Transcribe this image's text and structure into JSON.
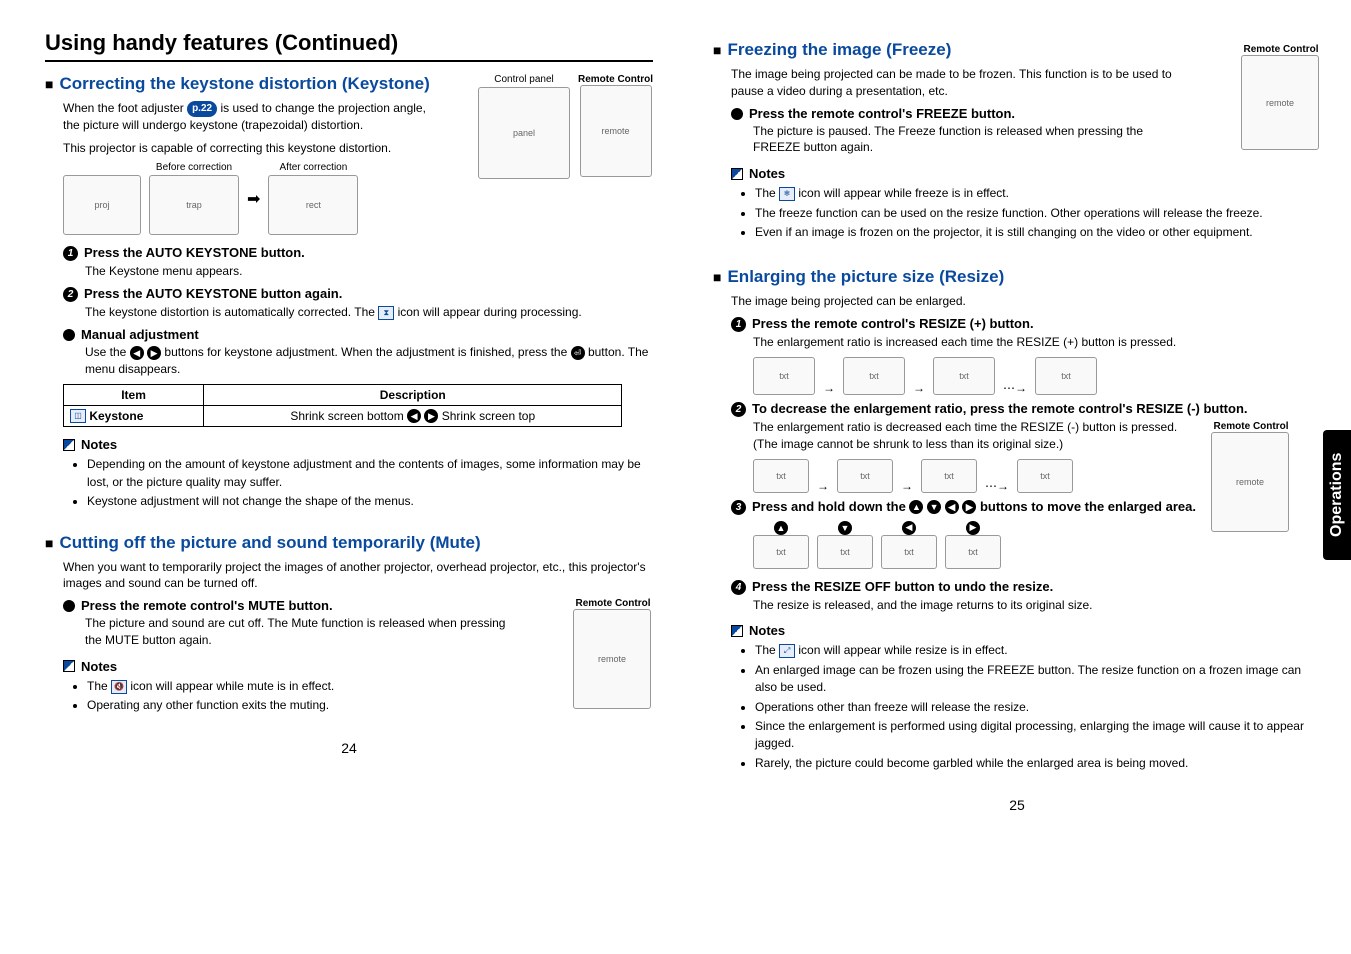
{
  "main_title": "Using handy features (Continued)",
  "side_tab": "Operations",
  "left": {
    "keystone": {
      "heading": "Correcting the keystone distortion (Keystone)",
      "intro_before_ref": "When the foot adjuster ",
      "page_ref": "p.22",
      "intro_after_ref": " is used to change the projection angle, the picture will undergo keystone (trapezoidal) distortion.",
      "intro2": "This projector is capable of correcting this keystone distortion.",
      "before_label": "Before correction",
      "after_label": "After correction",
      "control_panel_label": "Control panel",
      "remote_label": "Remote Control",
      "step1_title": "Press the AUTO KEYSTONE button.",
      "step1_body": "The Keystone menu appears.",
      "step2_title": "Press the AUTO KEYSTONE button again.",
      "step2_body_before": "The keystone distortion is automatically corrected. The ",
      "step2_body_after": " icon will appear during processing.",
      "manual_title": "Manual adjustment",
      "manual_body_a": "Use the ",
      "manual_body_b": " buttons for keystone adjustment. When the adjustment is finished, press the ",
      "manual_body_c": " button. The menu disappears.",
      "table": {
        "headers": [
          "Item",
          "Description"
        ],
        "row": {
          "item": "Keystone",
          "desc_a": "Shrink screen bottom ",
          "desc_b": " Shrink screen top"
        }
      },
      "notes_heading": "Notes",
      "notes": [
        "Depending on the amount of keystone adjustment and the contents of images, some information may be lost, or the picture quality may suffer.",
        "Keystone adjustment will not change the shape of the menus."
      ]
    },
    "mute": {
      "heading": "Cutting off the picture and sound temporarily (Mute)",
      "intro": "When you want to temporarily project the images of another projector, overhead projector, etc., this projector's images and sound can be turned off.",
      "remote_label": "Remote Control",
      "step_title": "Press the remote control's MUTE button.",
      "step_body": "The picture and sound are cut off. The Mute function is released when pressing the MUTE button again.",
      "notes_heading": "Notes",
      "note1_a": "The ",
      "note1_b": " icon will appear while mute is in effect.",
      "note2": "Operating any other function exits the muting."
    },
    "page_number": "24"
  },
  "right": {
    "freeze": {
      "heading": "Freezing the image (Freeze)",
      "intro": "The image being projected can be made to be frozen. This function is to be used to pause a video during a presentation, etc.",
      "remote_label": "Remote Control",
      "step_title": "Press the remote control's FREEZE button.",
      "step_body": "The picture is paused. The Freeze function is released when pressing the FREEZE button again.",
      "notes_heading": "Notes",
      "note1_a": "The ",
      "note1_b": " icon will appear while freeze is in effect.",
      "note2": "The freeze function can be used on the resize function. Other operations will release the freeze.",
      "note3": "Even if an image is frozen on the projector, it is still changing on the video or other equipment."
    },
    "resize": {
      "heading": "Enlarging the picture size (Resize)",
      "intro": "The image being projected can be enlarged.",
      "remote_label": "Remote Control",
      "step1_title": "Press the remote control's RESIZE (+)  button.",
      "step1_body": "The enlargement ratio is increased each time the RESIZE (+)  button is pressed.",
      "step2_title": "To decrease the enlargement ratio, press the remote control's RESIZE (-) button.",
      "step2_body": "The enlargement ratio is decreased each time the RESIZE (-) button is pressed. (The image cannot be shrunk to less than its original size.)",
      "step3_title_a": "Press and hold down the ",
      "step3_title_b": " buttons to move the enlarged area.",
      "step4_title": "Press the RESIZE OFF button to undo the resize.",
      "step4_body": "The resize is released, and the image returns to its original size.",
      "notes_heading": "Notes",
      "note1_a": "The ",
      "note1_b": " icon will appear while resize is in effect.",
      "notes_rest": [
        "An enlarged image can be frozen using the FREEZE button. The resize function on a frozen image can also be used.",
        "Operations other than freeze will release the resize.",
        "Since the enlargement is performed using digital processing, enlarging the image will cause it to appear jagged.",
        "Rarely, the picture could become garbled while the enlarged area is being moved."
      ]
    },
    "page_number": "25"
  }
}
